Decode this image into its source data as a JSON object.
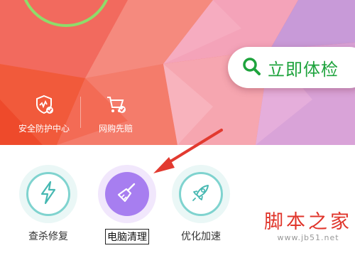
{
  "banner": {
    "check_button": {
      "label": "立即体检",
      "icon": "search-icon",
      "color": "#1ea33d"
    },
    "quick_items": [
      {
        "label": "安全防护中心",
        "icon": "shield-check-icon"
      },
      {
        "label": "网购先赔",
        "icon": "cart-check-icon"
      }
    ]
  },
  "tools": [
    {
      "label": "查杀修复",
      "icon": "lightning-icon"
    },
    {
      "label": "电脑清理",
      "icon": "broom-icon",
      "highlighted": true
    },
    {
      "label": "优化加速",
      "icon": "rocket-icon"
    }
  ],
  "watermark": {
    "text": "脚本之家",
    "url": "www.jb51.net"
  },
  "colors": {
    "accent_green": "#1ea33d",
    "teal": "#7fd3cf",
    "purple": "#a77ef0",
    "arrow_red": "#e23a30"
  }
}
